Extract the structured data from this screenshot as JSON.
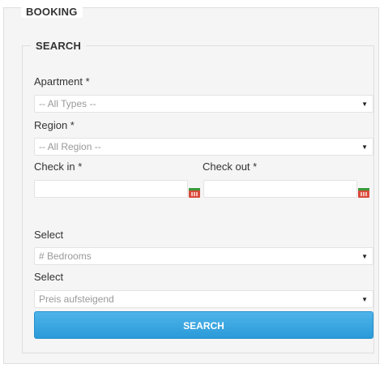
{
  "booking": {
    "title": "BOOKING",
    "search_section": {
      "title": "SEARCH",
      "apartment": {
        "label": "Apartment *",
        "value": "-- All Types --"
      },
      "region": {
        "label": "Region *",
        "value": "-- All Region --"
      },
      "check_in": {
        "label": "Check in *",
        "value": ""
      },
      "check_out": {
        "label": "Check out *",
        "value": ""
      },
      "bedrooms": {
        "label": "Select",
        "value": "# Bedrooms"
      },
      "sort": {
        "label": "Select",
        "value": "Preis aufsteigend"
      },
      "search_button": "SEARCH"
    }
  },
  "icons": {
    "dropdown": "chevron-down-icon",
    "calendar": "calendar-icon"
  },
  "colors": {
    "button_top": "#4fb4ea",
    "button_bottom": "#2a9ad8",
    "panel_bg": "#f5f5f5"
  }
}
